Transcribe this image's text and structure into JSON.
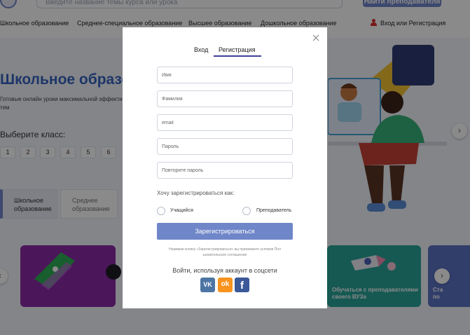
{
  "header": {
    "search_placeholder": "Введите название темы курса или урока",
    "find_teacher_label": "Найти преподавателя",
    "nav": [
      "Школьное образование",
      "Среднее-специальное образование",
      "Высшее образование",
      "Дошкольное образование"
    ],
    "login_link": "Вход или Регистрация"
  },
  "hero": {
    "title": "Школьное образо",
    "subtitle_line1": "Готовые онлайн уроки максимальной эффекти",
    "subtitle_line2": "тем",
    "grade_title": "Выберите класс:",
    "grades": [
      "1",
      "2",
      "3",
      "4",
      "5",
      "6"
    ],
    "edu_tabs": [
      {
        "line1": "Школьное",
        "line2": "образование"
      },
      {
        "line1": "Среднее",
        "line2": "образование"
      }
    ],
    "next_arrow": "›"
  },
  "cards": {
    "prev_arrow": "‹",
    "next_arrow": "›",
    "card_right_title_line1": "Обучаться с преподавателями",
    "card_right_title_line2": "своего ВУЗа",
    "card_edge_title_line1": "Ста",
    "card_edge_title_line2": "по"
  },
  "modal": {
    "tab_login": "Вход",
    "tab_register": "Регистрация",
    "placeholders": {
      "name": "Имя",
      "surname": "Фамилия",
      "email": "email",
      "password": "Пароль",
      "password_repeat": "Повторите пароль"
    },
    "role_title": "Хочу зарегистрироваться как:",
    "role_student": "Учащийся",
    "role_teacher": "Преподаватель",
    "submit_label": "Зарегистрироваться",
    "terms_line1": "Нажимая кнопку «Зарегистрироваться» вы принимаете условия Пол",
    "terms_line2": "ьзовательское соглашение",
    "social_title": "Войти, используя аккаунт в соцсети",
    "social": {
      "vk": "VK",
      "ok": "ok",
      "fb": "f"
    }
  },
  "colors": {
    "accent": "#6f86c9",
    "hero_title": "#3763c0",
    "overlay": "rgba(0,0,0,0.46)",
    "vk": "#4c75a3",
    "ok": "#f7931e",
    "fb": "#3b5998"
  }
}
